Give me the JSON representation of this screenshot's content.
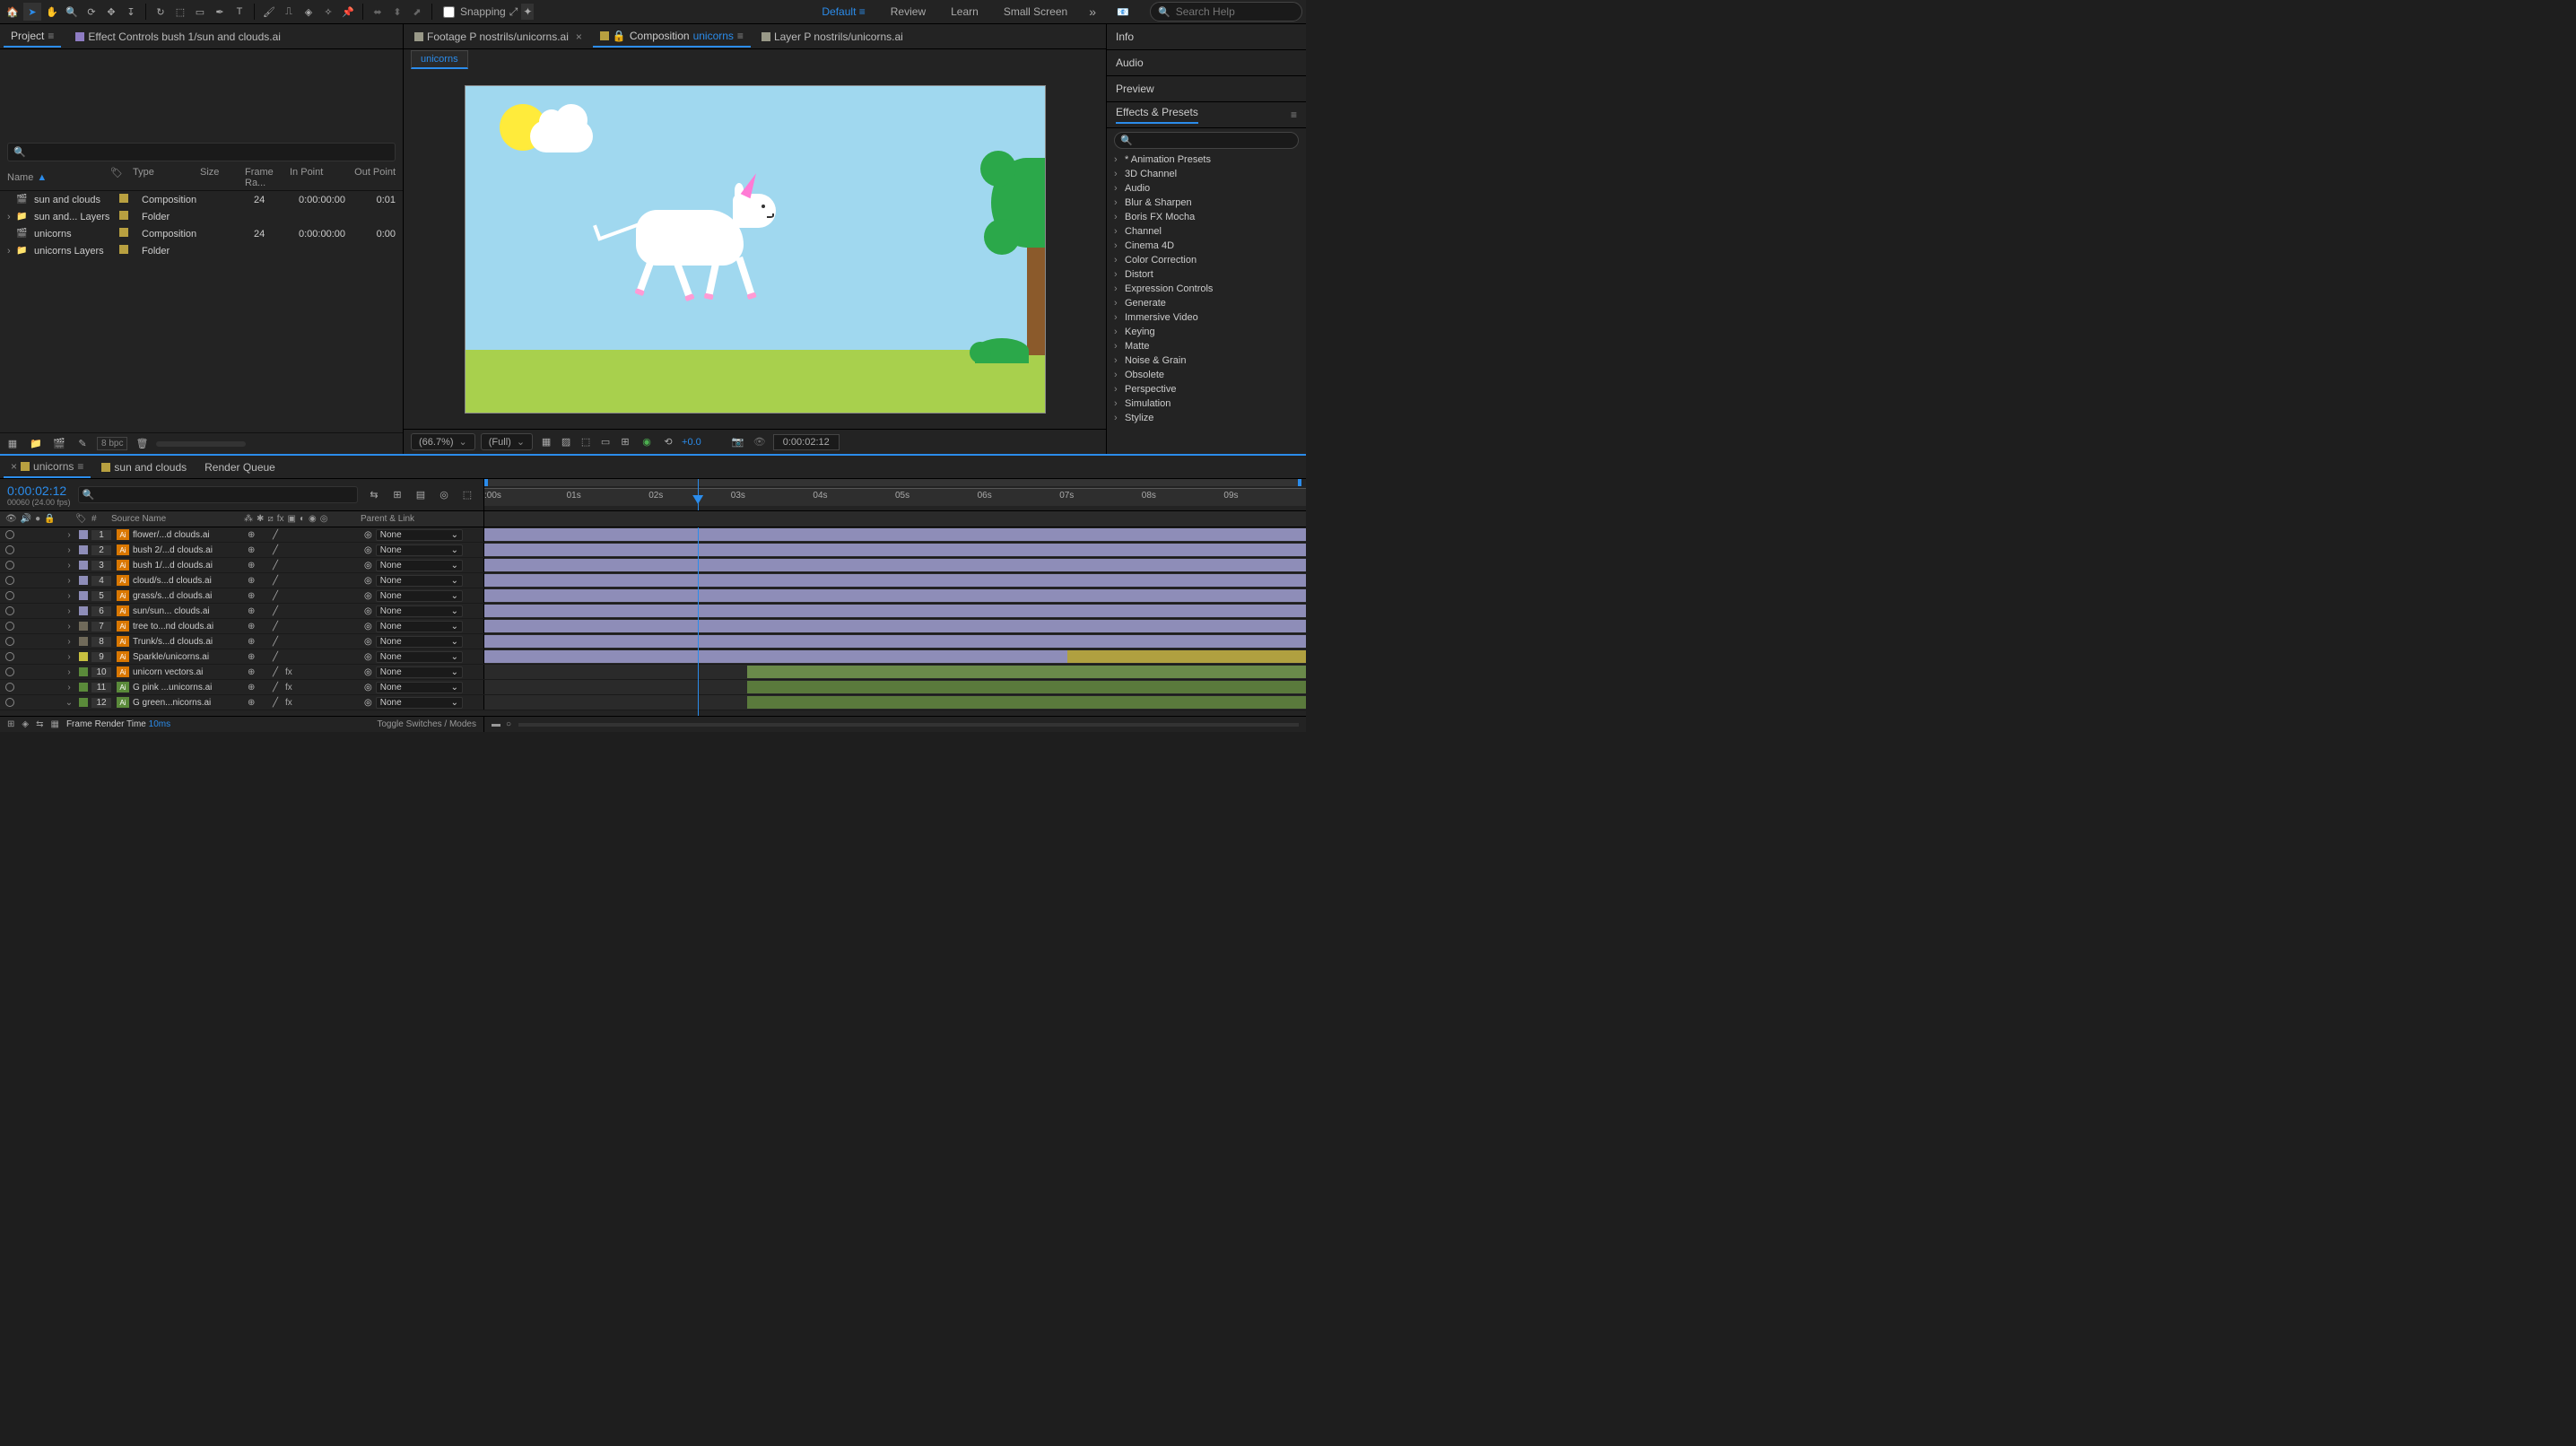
{
  "toolbar": {
    "snapping_label": "Snapping",
    "workspaces": [
      "Default",
      "Review",
      "Learn",
      "Small Screen"
    ],
    "active_workspace": "Default",
    "search_placeholder": "Search Help"
  },
  "project_panel": {
    "tabs": [
      {
        "label": "Project",
        "active": true
      },
      {
        "label": "Effect Controls bush 1/sun and clouds.ai",
        "active": false
      }
    ],
    "columns": {
      "name": "Name",
      "type": "Type",
      "size": "Size",
      "frame": "Frame Ra...",
      "in": "In Point",
      "out": "Out Point"
    },
    "rows": [
      {
        "twirl": "",
        "icon": "🎬",
        "name": "sun and clouds",
        "type": "Composition",
        "size": "",
        "frame": "24",
        "in": "0:00:00:00",
        "out": "0:01"
      },
      {
        "twirl": "›",
        "icon": "📁",
        "name": "sun and... Layers",
        "type": "Folder",
        "size": "",
        "frame": "",
        "in": "",
        "out": ""
      },
      {
        "twirl": "",
        "icon": "🎬",
        "name": "unicorns",
        "type": "Composition",
        "size": "",
        "frame": "24",
        "in": "0:00:00:00",
        "out": "0:00"
      },
      {
        "twirl": "›",
        "icon": "📁",
        "name": "unicorns Layers",
        "type": "Folder",
        "size": "",
        "frame": "",
        "in": "",
        "out": ""
      }
    ],
    "bpc": "8 bpc"
  },
  "comp_panel": {
    "tabs": [
      {
        "prefix": "Footage",
        "label": "P nostrils/unicorns.ai",
        "active": false,
        "close": true
      },
      {
        "prefix": "Composition",
        "label": "unicorns",
        "active": true,
        "close": false,
        "locked": true
      },
      {
        "prefix": "Layer",
        "label": "P nostrils/unicorns.ai",
        "active": false,
        "close": false
      }
    ],
    "flowchart": "unicorns",
    "footer": {
      "zoom": "(66.7%)",
      "resolution": "(Full)",
      "exposure": "+0.0",
      "timecode": "0:00:02:12"
    }
  },
  "right_panels": {
    "tabs": [
      "Info",
      "Audio",
      "Preview",
      "Effects & Presets"
    ],
    "active_tab": "Effects & Presets",
    "categories": [
      "* Animation Presets",
      "3D Channel",
      "Audio",
      "Blur & Sharpen",
      "Boris FX Mocha",
      "Channel",
      "Cinema 4D",
      "Color Correction",
      "Distort",
      "Expression Controls",
      "Generate",
      "Immersive Video",
      "Keying",
      "Matte",
      "Noise & Grain",
      "Obsolete",
      "Perspective",
      "Simulation",
      "Stylize"
    ]
  },
  "timeline": {
    "tabs": [
      {
        "close": true,
        "label": "unicorns",
        "active": true
      },
      {
        "close": false,
        "label": "sun and clouds",
        "active": false
      },
      {
        "close": false,
        "label": "Render Queue",
        "active": false,
        "nocolor": true
      }
    ],
    "timecode": "0:00:02:12",
    "fps": "00060 (24.00 fps)",
    "ruler": [
      ":00s",
      "01s",
      "02s",
      "03s",
      "04s",
      "05s",
      "06s",
      "07s",
      "08s",
      "09s"
    ],
    "cols": {
      "num": "#",
      "source": "Source Name",
      "parent": "Parent & Link",
      "none": "None"
    },
    "layers": [
      {
        "num": "1",
        "label": "#8e8db8",
        "name": "flower/...d clouds.ai",
        "icon": "Ai",
        "fx": false,
        "bar_start": 0,
        "bar_end": 100,
        "bar_class": ""
      },
      {
        "num": "2",
        "label": "#8e8db8",
        "name": "bush 2/...d clouds.ai",
        "icon": "Ai",
        "fx": false,
        "bar_start": 0,
        "bar_end": 100,
        "bar_class": ""
      },
      {
        "num": "3",
        "label": "#8e8db8",
        "name": "bush 1/...d clouds.ai",
        "icon": "Ai",
        "fx": false,
        "bar_start": 0,
        "bar_end": 100,
        "bar_class": ""
      },
      {
        "num": "4",
        "label": "#8e8db8",
        "name": "cloud/s...d clouds.ai",
        "icon": "Ai",
        "fx": false,
        "bar_start": 0,
        "bar_end": 100,
        "bar_class": ""
      },
      {
        "num": "5",
        "label": "#8e8db8",
        "name": "grass/s...d clouds.ai",
        "icon": "Ai",
        "fx": false,
        "bar_start": 0,
        "bar_end": 100,
        "bar_class": ""
      },
      {
        "num": "6",
        "label": "#8e8db8",
        "name": "sun/sun... clouds.ai",
        "icon": "Ai",
        "fx": false,
        "bar_start": 0,
        "bar_end": 100,
        "bar_class": ""
      },
      {
        "num": "7",
        "label": "#706a5a",
        "name": "tree to...nd clouds.ai",
        "icon": "Ai",
        "fx": false,
        "bar_start": 0,
        "bar_end": 100,
        "bar_class": ""
      },
      {
        "num": "8",
        "label": "#706a5a",
        "name": "Trunk/s...d clouds.ai",
        "icon": "Ai",
        "fx": false,
        "bar_start": 0,
        "bar_end": 100,
        "bar_class": ""
      },
      {
        "num": "9",
        "label": "#c8c040",
        "name": "Sparkle/unicorns.ai",
        "icon": "Ai",
        "fx": false,
        "bar_start": 0,
        "bar_end": 100,
        "bar_class": "sparkle",
        "sparkle_split": 71
      },
      {
        "num": "10",
        "label": "#5a8a3a",
        "name": "unicorn vectors.ai",
        "icon": "Ai",
        "fx": true,
        "bar_start": 32,
        "bar_end": 100,
        "bar_class": "green"
      },
      {
        "num": "11",
        "label": "#5a8a3a",
        "name": "G pink ...unicorns.ai",
        "icon": "Ai",
        "fx": true,
        "bar_start": 32,
        "bar_end": 100,
        "bar_class": "green-g",
        "green_icon": true
      },
      {
        "num": "12",
        "label": "#5a8a3a",
        "name": "G green...nicorns.ai",
        "icon": "Ai",
        "fx": true,
        "bar_start": 32,
        "bar_end": 100,
        "bar_class": "green-g",
        "green_icon": true,
        "twirl_down": true
      }
    ],
    "footer": {
      "frt_label": "Frame Render Time",
      "frt_value": "10ms",
      "toggle": "Toggle Switches / Modes"
    }
  }
}
